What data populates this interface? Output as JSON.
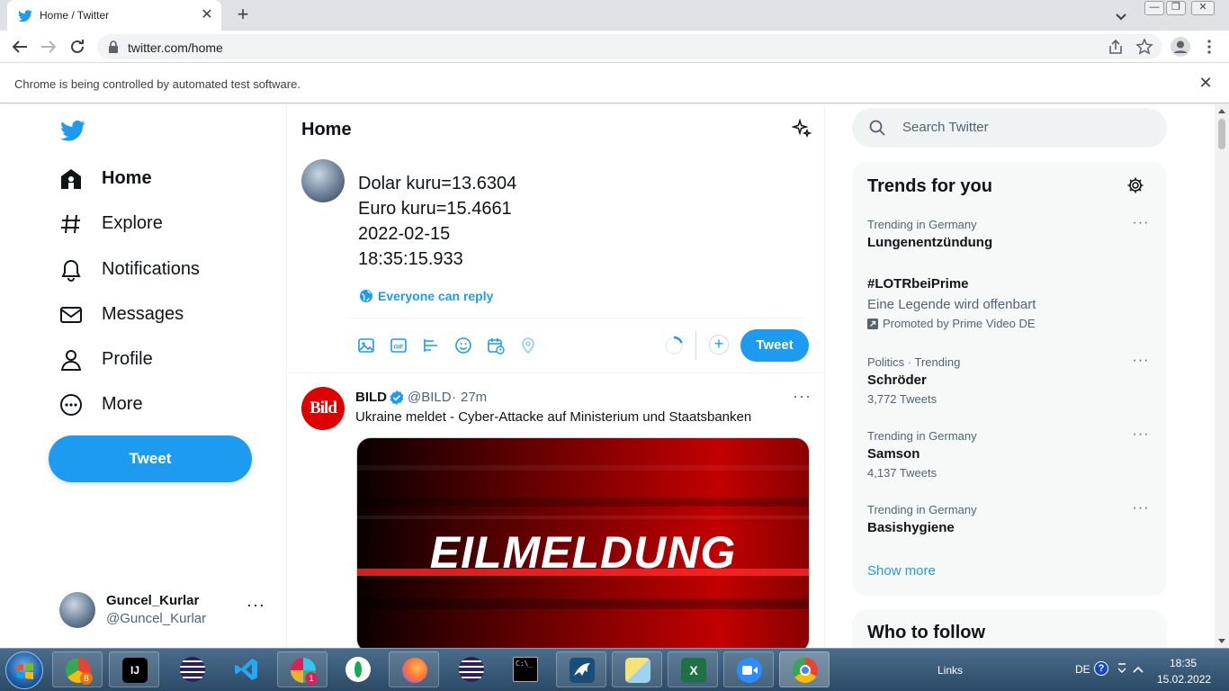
{
  "browser": {
    "tab_title": "Home / Twitter",
    "url": "twitter.com/home",
    "infobar_message": "Chrome is being controlled by automated test software."
  },
  "twitter": {
    "nav": [
      {
        "label": "Home",
        "icon": "home-icon"
      },
      {
        "label": "Explore",
        "icon": "hashtag-icon"
      },
      {
        "label": "Notifications",
        "icon": "bell-icon"
      },
      {
        "label": "Messages",
        "icon": "mail-icon"
      },
      {
        "label": "Profile",
        "icon": "person-icon"
      },
      {
        "label": "More",
        "icon": "more-circle-icon"
      }
    ],
    "tweet_button": "Tweet",
    "account": {
      "name": "Guncel_Kurlar",
      "handle": "@Guncel_Kurlar"
    },
    "header_title": "Home",
    "composer": {
      "lines": [
        "Dolar kuru=13.6304",
        "Euro kuru=15.4661",
        "2022-02-15",
        "18:35:15.933"
      ],
      "reply_setting": "Everyone can reply",
      "submit_label": "Tweet"
    },
    "feed": [
      {
        "name": "BILD",
        "handle": "@BILD",
        "time": "27m",
        "avatar_text": "Bild",
        "text": "Ukraine meldet - Cyber-Attacke auf Ministerium und Staatsbanken",
        "media_text": "EILMELDUNG"
      }
    ],
    "search_placeholder": "Search Twitter",
    "trends_title": "Trends for you",
    "trends": [
      {
        "meta": "Trending in Germany",
        "name": "Lungenentzündung",
        "count": ""
      },
      {
        "meta": "",
        "name": "#LOTRbeiPrime",
        "desc": "Eine Legende wird offenbart",
        "promoted": "Promoted by Prime Video DE"
      },
      {
        "meta": "Politics · Trending",
        "name": "Schröder",
        "count": "3,772 Tweets"
      },
      {
        "meta": "Trending in Germany",
        "name": "Samson",
        "count": "4,137 Tweets"
      },
      {
        "meta": "Trending in Germany",
        "name": "Basishygiene",
        "count": ""
      }
    ],
    "show_more": "Show more",
    "who_to_follow": "Who to follow",
    "accent_color": "#1d9bf0"
  },
  "taskbar": {
    "toolbar_label": "Links",
    "language": "DE",
    "time": "18:35",
    "date": "15.02.2022",
    "slack_badge": "1"
  }
}
